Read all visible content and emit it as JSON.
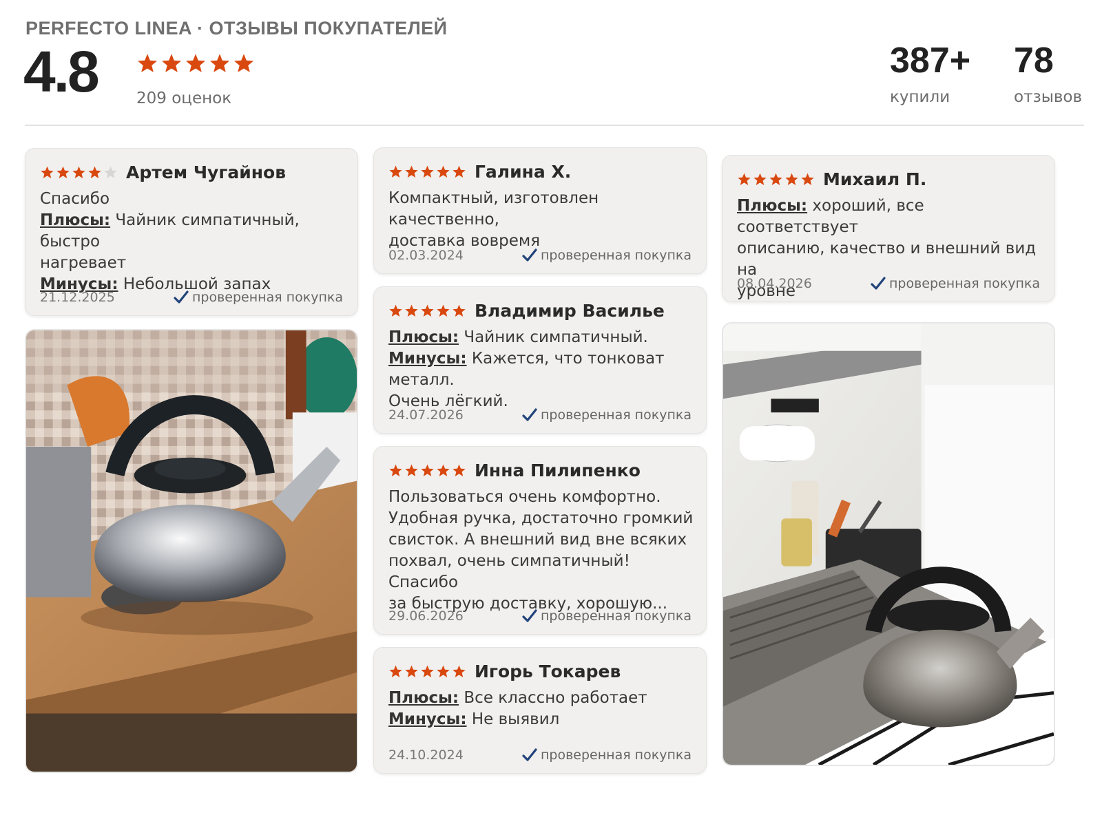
{
  "header": {
    "title": "PERFECTO LINEA · ОТЗЫВЫ ПОКУПАТЕЛЕЙ",
    "rating": "4.8",
    "rating_stars": 5,
    "ratings_count": "209 оценок",
    "bought_value": "387+",
    "bought_label": "купили",
    "reviews_value": "78",
    "reviews_label": "отзывов"
  },
  "colors": {
    "star_filled": "#d9480f",
    "star_empty": "#d7d6d3",
    "check": "#22437a"
  },
  "reviews": [
    {
      "author": "Артем Чугайнов",
      "stars": 4,
      "lines": [
        {
          "text": "Спасибо"
        },
        {
          "key": "Плюсы:",
          "text": " Чайник симпатичный, быстро"
        },
        {
          "text": "нагревает"
        },
        {
          "key": "Минусы:",
          "text": " Небольшой запах"
        }
      ],
      "date": "21.12.2025",
      "verified": "проверенная покупка"
    },
    {
      "author": "Галина Х.",
      "stars": 5,
      "lines": [
        {
          "text": "Компактный, изготовлен качественно,"
        },
        {
          "text": "доставка вовремя"
        }
      ],
      "date": "02.03.2024",
      "verified": "проверенная покупка"
    },
    {
      "author": "Михаил П.",
      "stars": 5,
      "lines": [
        {
          "key": "Плюсы:",
          "text": " хороший, все соответствует"
        },
        {
          "text": "описанию, качество и внешний вид на"
        },
        {
          "text": "уровне"
        }
      ],
      "date": "08.04.2026",
      "verified": "проверенная покупка"
    },
    {
      "author": "Владимир Василье",
      "stars": 5,
      "lines": [
        {
          "key": "Плюсы:",
          "text": " Чайник симпатичный."
        },
        {
          "key": "Минусы:",
          "text": " Кажется, что тонковат металл."
        },
        {
          "text": "Очень лёгкий."
        }
      ],
      "date": "24.07.2026",
      "verified": "проверенная покупка"
    },
    {
      "author": "Инна Пилипенко",
      "stars": 5,
      "lines": [
        {
          "text": "Пользоваться очень комфортно."
        },
        {
          "text": "Удобная ручка, достаточно громкий"
        },
        {
          "text": "свисток. А внешний вид вне всяких"
        },
        {
          "text": "похвал, очень симпатичный! Спасибо"
        },
        {
          "text": "за быструю доставку, хорошую..."
        }
      ],
      "date": "29.06.2026",
      "verified": "проверенная покупка"
    },
    {
      "author": "Игорь Токарев",
      "stars": 5,
      "lines": [
        {
          "key": "Плюсы:",
          "text": " Все классно работает"
        },
        {
          "key": "Минусы:",
          "text": " Не выявил"
        }
      ],
      "date": "24.10.2024",
      "verified": "проверенная покупка"
    }
  ],
  "photos": [
    "kettle-on-table-photo",
    "kettle-on-stove-photo"
  ]
}
